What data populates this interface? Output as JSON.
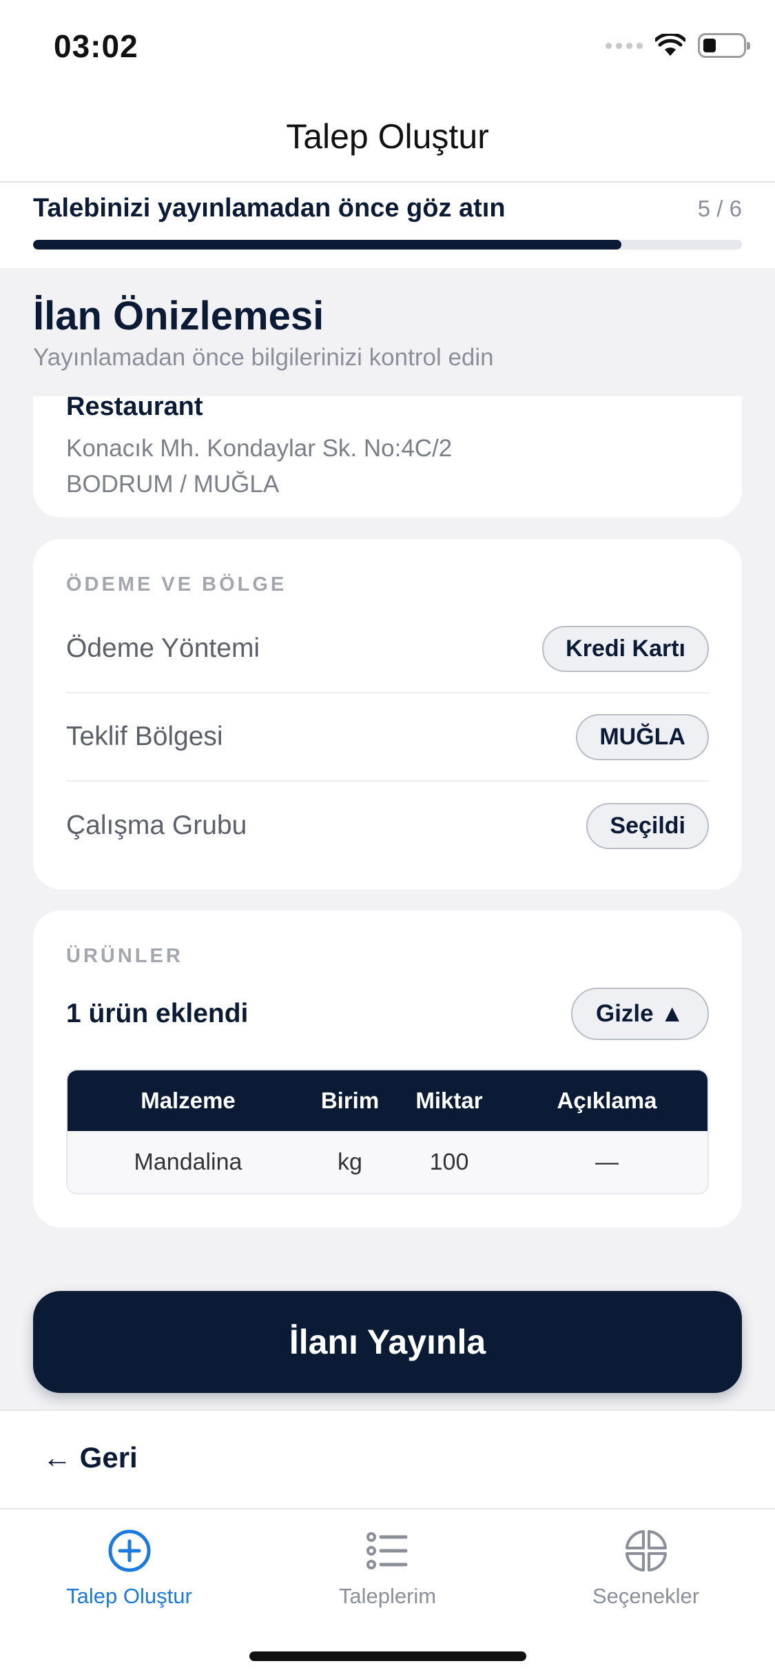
{
  "status_bar": {
    "time": "03:02",
    "wifi_icon": "wifi-icon",
    "battery_icon": "battery-icon"
  },
  "header": {
    "title": "Talep Oluştur"
  },
  "progress": {
    "text": "Talebinizi yayınlamadan önce göz atın",
    "step_label": "5 / 6",
    "fill_fraction": 0.83
  },
  "preview": {
    "title": "İlan Önizlemesi",
    "subtitle": "Yayınlamadan önce bilgilerinizi kontrol edin"
  },
  "address_card": {
    "name": "Restaurant",
    "line1": "Konacık Mh. Kondaylar Sk. No:4C/2",
    "line2": "BODRUM / MUĞLA"
  },
  "payment_card": {
    "label": "ÖDEME VE BÖLGE",
    "rows": [
      {
        "key": "Ödeme Yöntemi",
        "value": "Kredi Kartı"
      },
      {
        "key": "Teklif Bölgesi",
        "value": "MUĞLA"
      },
      {
        "key": "Çalışma Grubu",
        "value": "Seçildi"
      }
    ]
  },
  "products_card": {
    "label": "ÜRÜNLER",
    "count_text": "1 ürün eklendi",
    "hide_label": "Gizle ▲",
    "columns": [
      "Malzeme",
      "Birim",
      "Miktar",
      "Açıklama"
    ],
    "rows": [
      [
        "Mandalina",
        "kg",
        "100",
        "—"
      ]
    ]
  },
  "publish_label": "İlanı Yayınla",
  "back_label": "← Geri",
  "tabs": [
    {
      "label": "Talep Oluştur",
      "icon": "plus-circle-icon",
      "active": true
    },
    {
      "label": "Taleplerim",
      "icon": "list-icon",
      "active": false
    },
    {
      "label": "Seçenekler",
      "icon": "grid-options-icon",
      "active": false
    }
  ],
  "colors": {
    "primary": "#0b1b36",
    "accent": "#1a7ae0",
    "background": "#f2f2f4"
  }
}
